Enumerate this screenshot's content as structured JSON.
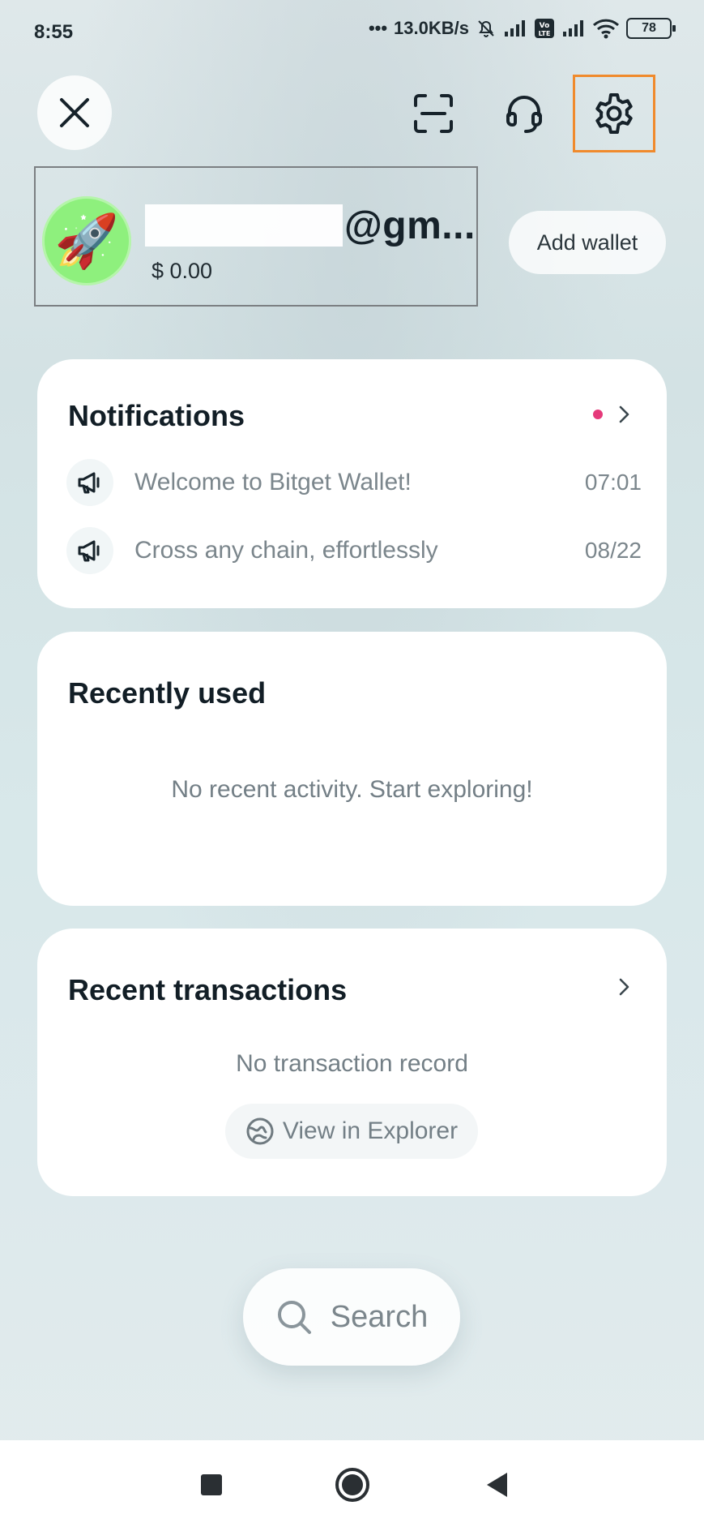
{
  "status_bar": {
    "time": "8:55",
    "network_speed": "13.0KB/s",
    "battery": "78"
  },
  "account": {
    "name_suffix": "@gm...",
    "balance": "$ 0.00",
    "avatar_emoji": "🚀",
    "avatar_color": "#8ef07d",
    "add_wallet_label": "Add wallet"
  },
  "notifications": {
    "title": "Notifications",
    "unread_dot_color": "#e5397a",
    "items": [
      {
        "text": "Welcome to Bitget Wallet!",
        "time": "07:01"
      },
      {
        "text": "Cross any chain, effortlessly",
        "time": "08/22"
      }
    ]
  },
  "recently_used": {
    "title": "Recently used",
    "empty_text": "No recent activity. Start exploring!"
  },
  "recent_transactions": {
    "title": "Recent transactions",
    "empty_text": "No transaction record",
    "explorer_label": "View in Explorer"
  },
  "search": {
    "label": "Search"
  },
  "icons": {
    "close": "close-icon",
    "scan": "scan-icon",
    "support": "headset-icon",
    "settings": "gear-icon",
    "notification": "megaphone-icon",
    "explorer": "globe-icon",
    "search": "search-icon"
  },
  "colors": {
    "highlight": "#f08a2c",
    "text_primary": "#121e26",
    "text_secondary": "#7b868c"
  }
}
